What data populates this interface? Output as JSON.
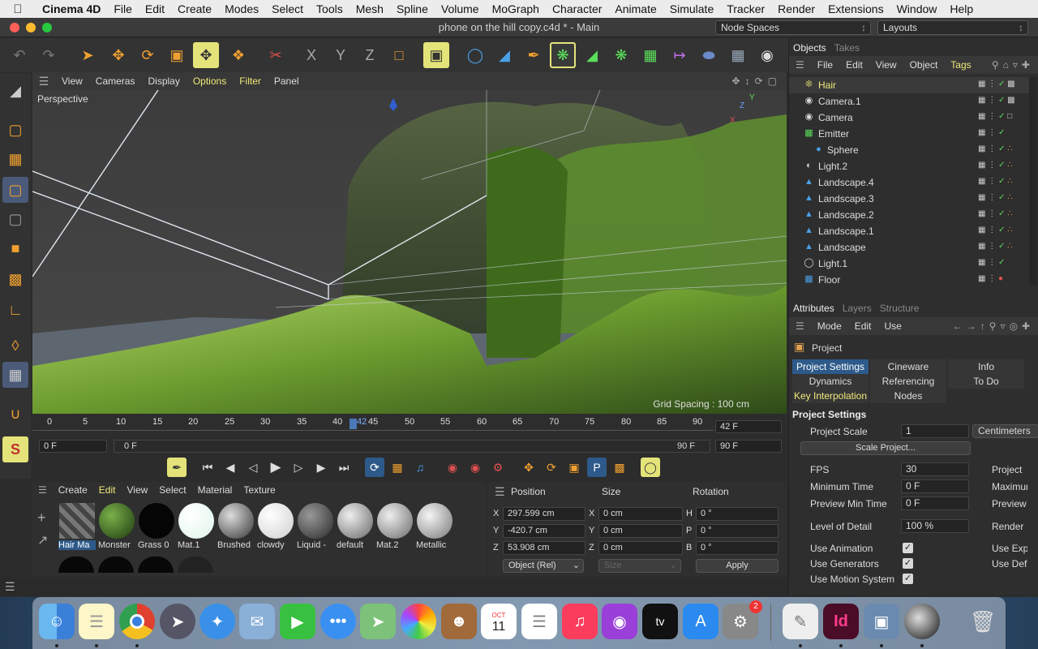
{
  "menubar": {
    "apple": "",
    "app": "Cinema 4D",
    "items": [
      "File",
      "Edit",
      "Create",
      "Modes",
      "Select",
      "Tools",
      "Mesh",
      "Spline",
      "Volume",
      "MoGraph",
      "Character",
      "Animate",
      "Simulate",
      "Tracker",
      "Render",
      "Extensions",
      "Window",
      "Help"
    ]
  },
  "window": {
    "title": "phone on the hill copy.c4d * - Main",
    "node_spaces": "Node Spaces",
    "layouts": "Layouts"
  },
  "viewport": {
    "menu": [
      "View",
      "Cameras",
      "Display",
      "Options",
      "Filter",
      "Panel"
    ],
    "label": "Perspective",
    "grid_spacing": "Grid Spacing : 100 cm",
    "axes": {
      "x": "X",
      "y": "Y",
      "z": "Z"
    }
  },
  "timeline": {
    "ticks": [
      "0",
      "5",
      "10",
      "15",
      "20",
      "25",
      "30",
      "35",
      "40",
      "45",
      "50",
      "55",
      "60",
      "65",
      "70",
      "75",
      "80",
      "85",
      "90"
    ],
    "current": "42",
    "current_frame": "42 F",
    "start": "0 F",
    "range_start": "0 F",
    "range_end": "90 F",
    "end": "90 F"
  },
  "materials": {
    "menu": [
      "Create",
      "Edit",
      "View",
      "Select",
      "Material",
      "Texture"
    ],
    "items": [
      "Hair Ma",
      "Monster",
      "Grass 0",
      "Mat.1",
      "Brushed",
      "clowdy",
      "Liquid -",
      "default",
      "Mat.2",
      "Metallic"
    ]
  },
  "coords": {
    "headers": {
      "position": "Position",
      "size": "Size",
      "rotation": "Rotation"
    },
    "rows": [
      {
        "axis": "X",
        "pos": "297.599 cm",
        "size_axis": "X",
        "size": "0 cm",
        "rot_axis": "H",
        "rot": "0 °"
      },
      {
        "axis": "Y",
        "pos": "-420.7 cm",
        "size_axis": "Y",
        "size": "0 cm",
        "rot_axis": "P",
        "rot": "0 °"
      },
      {
        "axis": "Z",
        "pos": "53.908 cm",
        "size_axis": "Z",
        "size": "0 cm",
        "rot_axis": "B",
        "rot": "0 °"
      }
    ],
    "mode": "Object (Rel)",
    "size_mode": "Size",
    "apply": "Apply"
  },
  "objects": {
    "tabs": [
      "Objects",
      "Takes"
    ],
    "menu": [
      "File",
      "Edit",
      "View",
      "Object",
      "Tags"
    ],
    "items": [
      {
        "name": "Hair",
        "icon": "hair-icon",
        "color": "#f0e87a"
      },
      {
        "name": "Camera.1",
        "icon": "camera-icon",
        "color": "#ffffff"
      },
      {
        "name": "Camera",
        "icon": "camera-icon",
        "color": "#ffffff"
      },
      {
        "name": "Emitter",
        "icon": "emitter-icon",
        "color": "#5be05b"
      },
      {
        "name": "Sphere",
        "icon": "sphere-icon",
        "color": "#4aa0e8"
      },
      {
        "name": "Light.2",
        "icon": "light-icon",
        "color": "#ffffff"
      },
      {
        "name": "Landscape.4",
        "icon": "landscape-icon",
        "color": "#4aa0e8"
      },
      {
        "name": "Landscape.3",
        "icon": "landscape-icon",
        "color": "#4aa0e8"
      },
      {
        "name": "Landscape.2",
        "icon": "landscape-icon",
        "color": "#4aa0e8"
      },
      {
        "name": "Landscape.1",
        "icon": "landscape-icon",
        "color": "#4aa0e8"
      },
      {
        "name": "Landscape",
        "icon": "landscape-icon",
        "color": "#4aa0e8"
      },
      {
        "name": "Light.1",
        "icon": "bulb-icon",
        "color": "#ffffff"
      },
      {
        "name": "Floor",
        "icon": "floor-icon",
        "color": "#4aa0e8"
      }
    ]
  },
  "attributes": {
    "tabs": [
      "Attributes",
      "Layers",
      "Structure"
    ],
    "menu": [
      "Mode",
      "Edit",
      "Use"
    ],
    "object": "Project",
    "tabs_grid": [
      "Project Settings",
      "Cineware",
      "Info",
      "Dynamics",
      "Referencing",
      "To Do",
      "Key Interpolation",
      "Nodes"
    ],
    "section": "Project Settings",
    "project_scale_label": "Project Scale",
    "project_scale": "1",
    "project_scale_unit": "Centimeters",
    "scale_project": "Scale Project...",
    "fps_label": "FPS",
    "fps": "30",
    "fps_right": "Project",
    "min_time_label": "Minimum Time",
    "min_time": "0 F",
    "min_time_right": "Maximum",
    "preview_min_label": "Preview Min Time",
    "preview_min": "0 F",
    "preview_min_right": "Preview",
    "lod_label": "Level of Detail",
    "lod": "100 %",
    "lod_right": "Render",
    "use_animation": "Use Animation",
    "use_animation_right": "Use Exp",
    "use_generators": "Use Generators",
    "use_generators_right": "Use Def",
    "use_motion": "Use Motion System"
  },
  "dock": {
    "calendar_month": "OCT",
    "calendar_day": "11",
    "badge": "2"
  },
  "colors": {
    "accent_yellow": "#e4e37a",
    "selection_blue": "#2d5a8a"
  }
}
